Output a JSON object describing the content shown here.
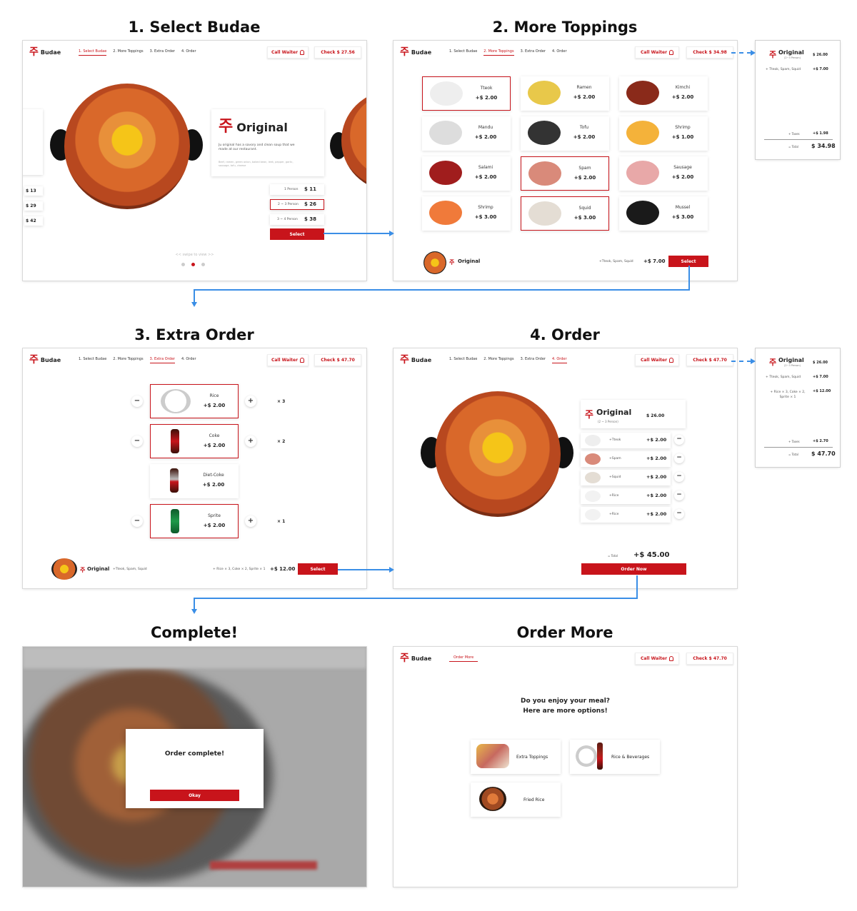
{
  "titles": {
    "s1": "1. Select Budae",
    "s2": "2. More Toppings",
    "s3": "3. Extra Order",
    "s4": "4. Order",
    "s5": "Complete!",
    "s6": "Order More"
  },
  "header": {
    "logo_text": "Budae",
    "logo_mark": "주",
    "nav": [
      "1. Select Budae",
      "2. More Toppings",
      "3. Extra Order",
      "4. Order"
    ],
    "nav_more": "Order More",
    "call_waiter": "Call Waiter",
    "check_s1": "Check $ 27.56",
    "check_s2": "Check $ 34.98",
    "check_s3": "Check $ 47.70",
    "check_s4": "Check $ 47.70",
    "check_s6": "Check $ 47.70"
  },
  "select": {
    "name": "Original",
    "desc": "Ju original has a savory and clean soup that we made at our restaurant.",
    "ingredients": "Beef, ramen, green onion, baked bean, leek, pepper, garlic, sausage, tofu, cheese",
    "sizes": [
      {
        "label": "1 Person",
        "price": "$ 11"
      },
      {
        "label": "2 ~ 3 Person",
        "price": "$ 26"
      },
      {
        "label": "3 ~ 4 Person",
        "price": "$ 38"
      }
    ],
    "left_prices": [
      "$ 13",
      "$ 29",
      "$ 42"
    ],
    "select_btn": "Select",
    "swipe": "<< swipe to view >>"
  },
  "toppings": {
    "items": [
      {
        "name": "Tteok",
        "price": "+$ 2.00"
      },
      {
        "name": "Ramen",
        "price": "+$ 2.00"
      },
      {
        "name": "Kimchi",
        "price": "+$ 2.00"
      },
      {
        "name": "Mandu",
        "price": "+$ 2.00"
      },
      {
        "name": "Tofu",
        "price": "+$ 2.00"
      },
      {
        "name": "Shrimp",
        "price": "+$ 1.00"
      },
      {
        "name": "Salami",
        "price": "+$ 2.00"
      },
      {
        "name": "Spam",
        "price": "+$ 2.00"
      },
      {
        "name": "Sausage",
        "price": "+$ 2.00"
      },
      {
        "name": "Shrimp",
        "price": "+$ 3.00"
      },
      {
        "name": "Squid",
        "price": "+$ 3.00"
      },
      {
        "name": "Mussel",
        "price": "+$ 3.00"
      }
    ],
    "footer_name": "Original",
    "footer_items": "+Tteok, Spam, Squid",
    "footer_price": "+$ 7.00",
    "select_btn": "Select"
  },
  "receipt1": {
    "name": "Original",
    "sub": "(2~3 Person)",
    "price": "$ 26.00",
    "line1": "+ Tteok, Spam, Squid",
    "line1_price": "+$ 7.00",
    "taxes_label": "+ Taxes",
    "taxes": "+$ 1.98",
    "total_label": "= Total",
    "total": "$ 34.98"
  },
  "extra": {
    "items": [
      {
        "name": "Rice",
        "price": "+$ 2.00",
        "qty": "× 3"
      },
      {
        "name": "Coke",
        "price": "+$ 2.00",
        "qty": "× 2"
      },
      {
        "name": "Diet-Coke",
        "price": "+$ 2.00",
        "qty": ""
      },
      {
        "name": "Sprite",
        "price": "+$ 2.00",
        "qty": "× 1"
      }
    ],
    "footer_name": "Original",
    "footer_items": "+Tteok, Spam, Squid",
    "footer_extra": "+ Rice × 3, Coke × 2, Sprite × 1",
    "footer_price": "+$ 12.00",
    "select_btn": "Select"
  },
  "order": {
    "name": "Original",
    "sub": "(2 ~ 3 Person)",
    "price": "$ 26.00",
    "lines": [
      {
        "name": "+Tteok",
        "price": "+$ 2.00"
      },
      {
        "name": "+Spam",
        "price": "+$ 2.00"
      },
      {
        "name": "+Squid",
        "price": "+$ 2.00"
      },
      {
        "name": "+Rice",
        "price": "+$ 2.00"
      },
      {
        "name": "+Rice",
        "price": "+$ 2.00"
      }
    ],
    "total_label": "= Total",
    "total": "+$ 45.00",
    "order_btn": "Order Now"
  },
  "receipt2": {
    "name": "Original",
    "sub": "(2~3 Person)",
    "price": "$ 26.00",
    "line1": "+ Tteok, Spam, Squid",
    "line1_price": "+$ 7.00",
    "line2": "+ Rice × 3, Coke × 2, Sprite × 1",
    "line2_price": "+$ 12.00",
    "taxes_label": "+ Taxes",
    "taxes": "+$ 2.70",
    "total_label": "= Total",
    "total": "$ 47.70"
  },
  "complete": {
    "message": "Order complete!",
    "okay": "Okay"
  },
  "more": {
    "question1": "Do you enjoy your meal?",
    "question2": "Here are more options!",
    "options": [
      "Extra Toppings",
      "Rice & Beverages",
      "Fried Rice"
    ]
  },
  "colors": {
    "accent": "#c8141b",
    "arrow": "#3a8ee6"
  }
}
